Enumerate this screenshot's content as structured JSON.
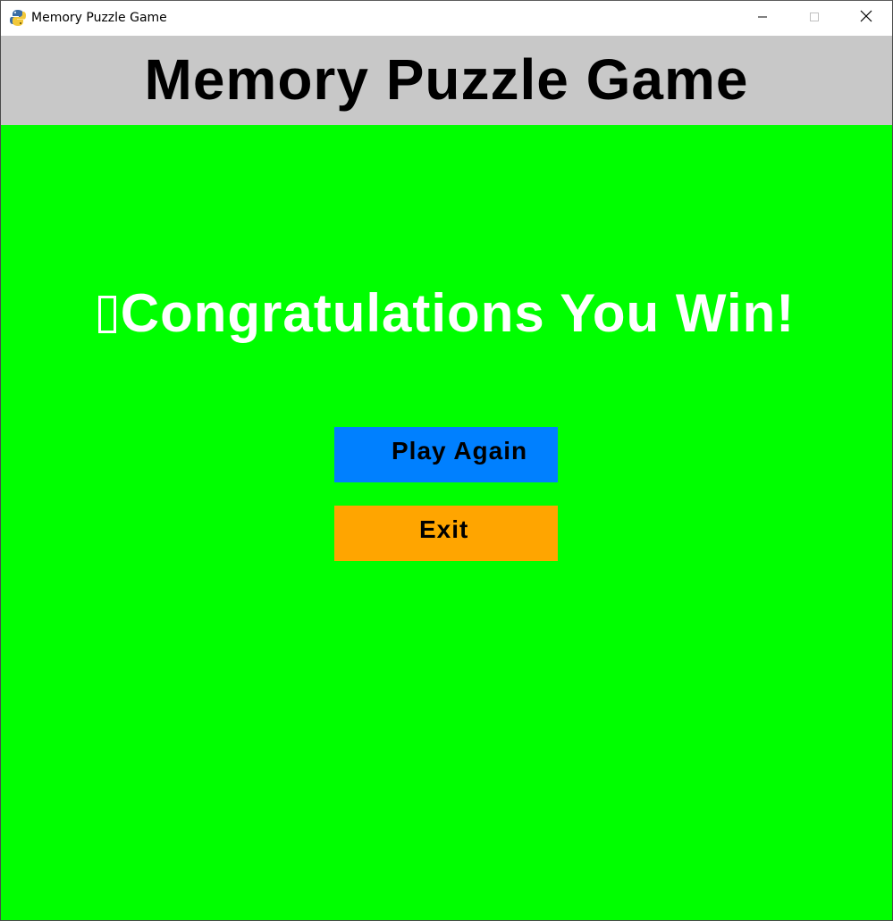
{
  "window": {
    "title": "Memory Puzzle Game",
    "icon": "pygame-snake-icon",
    "controls": {
      "minimize_icon": "minimize-icon",
      "maximize_icon": "maximize-icon",
      "close_icon": "close-icon"
    }
  },
  "game": {
    "background_color": "#00ff00",
    "header": {
      "title": "Memory Puzzle Game",
      "band_color": "#c8c8c8"
    },
    "win_screen": {
      "message": "Congratulations You Win!",
      "missing_glyph_icon": "missing-glyph-box-icon",
      "message_color": "#ffffff"
    },
    "buttons": {
      "play_again": {
        "label": "Play Again",
        "color": "#0080ff"
      },
      "exit": {
        "label": "Exit",
        "color": "#ffa500"
      }
    }
  }
}
